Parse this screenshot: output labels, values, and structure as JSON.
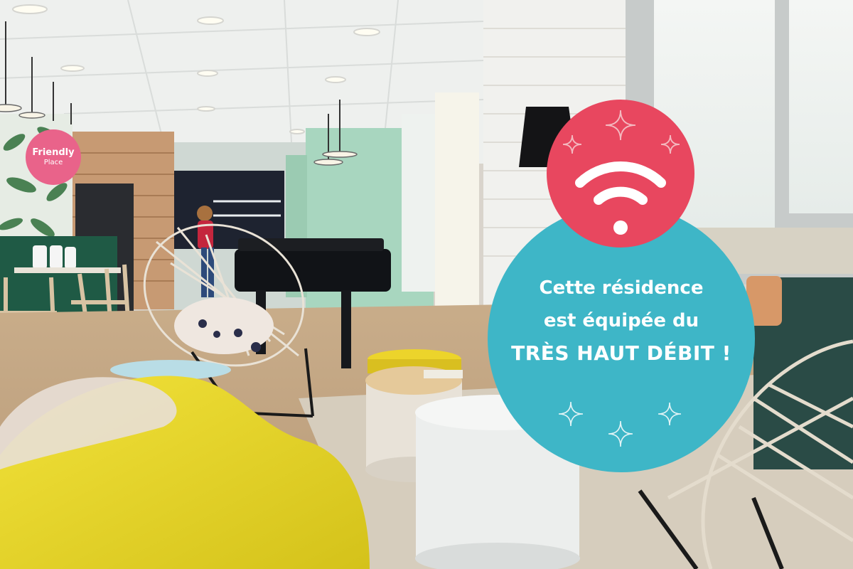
{
  "badge": {
    "line1": "Friendly",
    "line2": "Place"
  },
  "headline": {
    "line1": "Cette résidence",
    "line2": "est équipée du",
    "line3": "TRÈS HAUT DÉBIT !"
  },
  "colors": {
    "badge_pink": "#e9638a",
    "circle_pink": "#e8475f",
    "circle_teal": "#3eb6c7",
    "text_white": "#ffffff"
  },
  "icons": [
    "wifi-icon",
    "sparkle-icon"
  ]
}
